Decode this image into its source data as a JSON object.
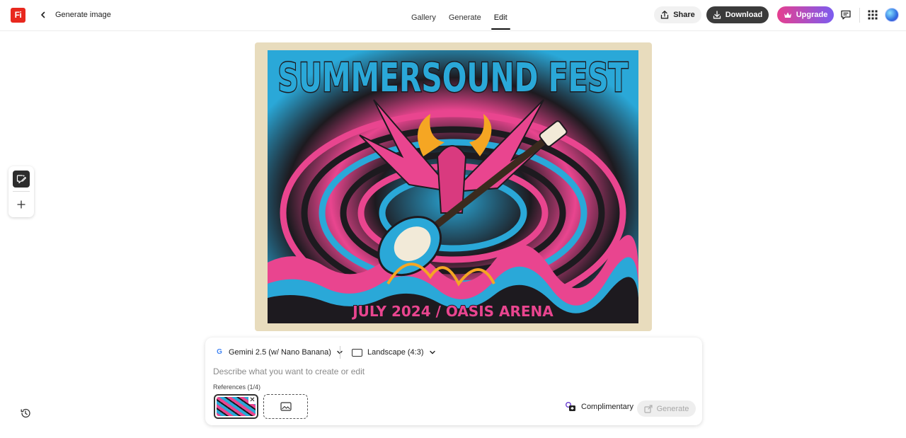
{
  "header": {
    "logo_text": "Fi",
    "title": "Generate image",
    "tabs": [
      {
        "label": "Gallery",
        "active": false
      },
      {
        "label": "Generate",
        "active": false
      },
      {
        "label": "Edit",
        "active": true
      }
    ],
    "share_label": "Share",
    "download_label": "Download",
    "upgrade_label": "Upgrade",
    "icons": [
      "chevron-left-icon",
      "share-icon",
      "download-icon",
      "crown-icon",
      "comment-icon",
      "apps-grid-icon"
    ]
  },
  "canvas": {
    "poster_title": "SUMMERSOUND FEST",
    "poster_subtitle": "JULY 2024 / OASIS ARENA",
    "frame_color": "#e8dcbd"
  },
  "panel": {
    "model_label": "Gemini 2.5 (w/ Nano Banana)",
    "aspect_label": "Landscape (4:3)",
    "prompt_placeholder": "Describe what you want to create or edit",
    "prompt_value": "",
    "references_label": "References (1/4)",
    "ref_close": "✕",
    "credits_label": "Complimentary",
    "generate_label": "Generate",
    "generate_enabled": false
  },
  "colors": {
    "accent_pink": "#e63f8f",
    "accent_purple": "#7b5cf0",
    "dark_button": "#3b3b3b",
    "brand_red": "#e8281e"
  }
}
